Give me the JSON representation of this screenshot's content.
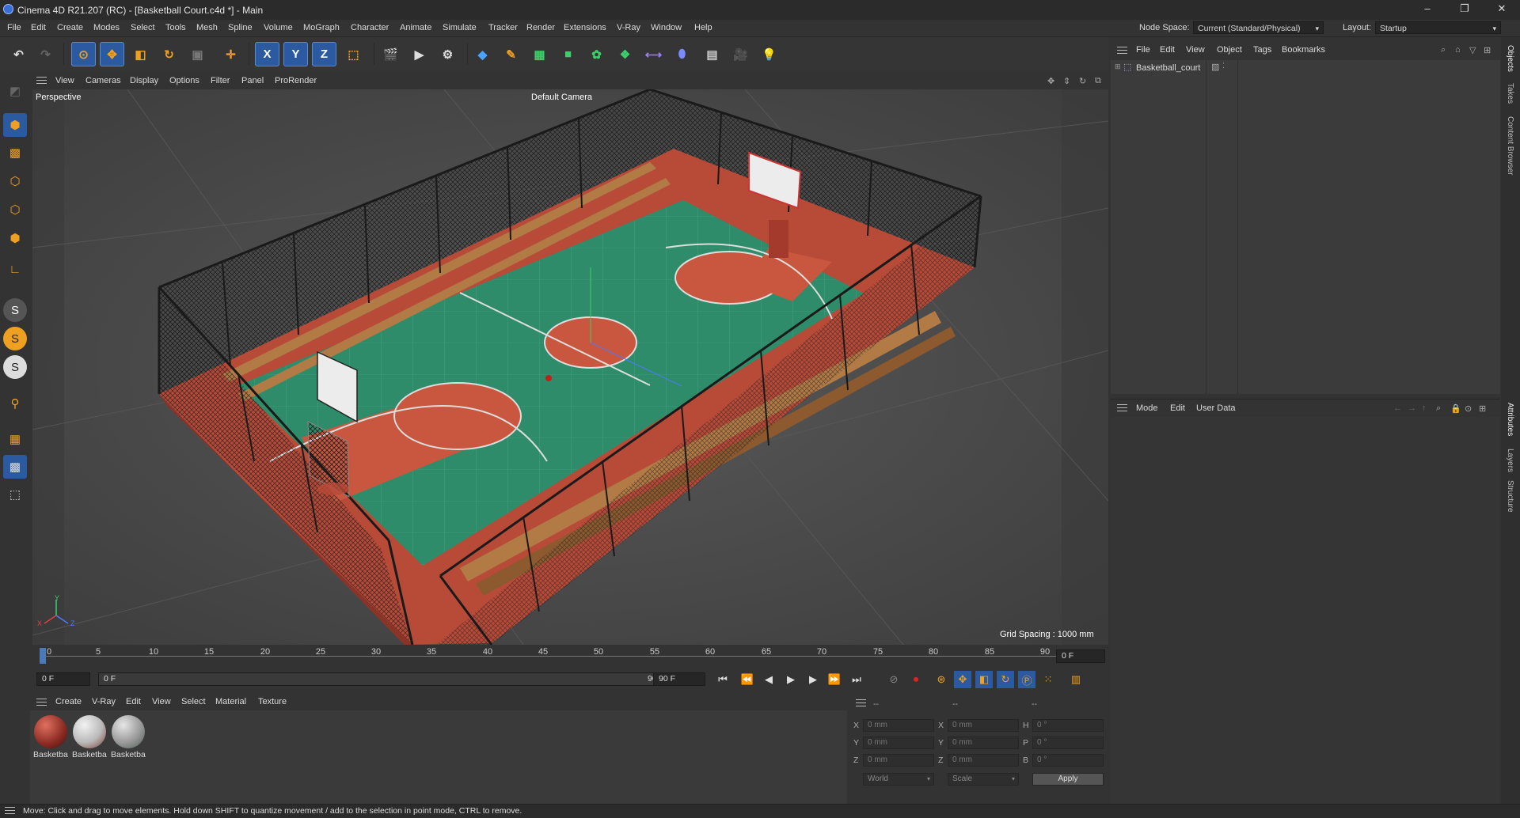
{
  "title_bar": {
    "title": "Cinema 4D R21.207 (RC) - [Basketball Court.c4d *] - Main"
  },
  "menu": {
    "items": [
      "File",
      "Edit",
      "Create",
      "Modes",
      "Select",
      "Tools",
      "Mesh",
      "Spline",
      "Volume",
      "MoGraph",
      "Character",
      "Animate",
      "Simulate",
      "Tracker",
      "Render",
      "Extensions",
      "V-Ray",
      "Window",
      "Help"
    ],
    "node_space_label": "Node Space:",
    "node_space_value": "Current (Standard/Physical)",
    "layout_label": "Layout:",
    "layout_value": "Startup"
  },
  "toolbar": {
    "axis_x": "X",
    "axis_y": "Y",
    "axis_z": "Z"
  },
  "left_tools": {
    "s1": "S",
    "s2": "S",
    "s3": "S"
  },
  "viewport": {
    "menu": [
      "View",
      "Cameras",
      "Display",
      "Options",
      "Filter",
      "Panel",
      "ProRender"
    ],
    "label": "Perspective",
    "camera": "Default Camera",
    "grid_spacing": "Grid Spacing : 1000 mm",
    "axis_y": "Y",
    "axis_x": "X",
    "axis_z": "Z"
  },
  "timeline": {
    "ticks": [
      "0",
      "5",
      "10",
      "15",
      "20",
      "25",
      "30",
      "35",
      "40",
      "45",
      "50",
      "55",
      "60",
      "65",
      "70",
      "75",
      "80",
      "85",
      "90"
    ],
    "current_frame": "0 F"
  },
  "transport": {
    "start_frame": "0 F",
    "range_start": "0 F",
    "range_end": "90 F",
    "end_frame": "90 F"
  },
  "material_manager": {
    "menu": [
      "Create",
      "V-Ray",
      "Edit",
      "View",
      "Select",
      "Material",
      "Texture"
    ],
    "materials": [
      {
        "name": "Basketba",
        "color": "#8a2a22"
      },
      {
        "name": "Basketba",
        "color": "#b9b9b9"
      },
      {
        "name": "Basketba",
        "color": "#9a9a9a"
      }
    ]
  },
  "coordinates": {
    "header_dashes": [
      "--",
      "--",
      "--"
    ],
    "pos_labels": [
      "X",
      "Y",
      "Z"
    ],
    "size_labels": [
      "X",
      "Y",
      "Z"
    ],
    "rot_labels": [
      "H",
      "P",
      "B"
    ],
    "pos_values": [
      "0 mm",
      "0 mm",
      "0 mm"
    ],
    "size_values": [
      "0 mm",
      "0 mm",
      "0 mm"
    ],
    "rot_values": [
      "0 °",
      "0 °",
      "0 °"
    ],
    "world_select": "World",
    "scale_select": "Scale",
    "apply_label": "Apply"
  },
  "object_manager": {
    "menu": [
      "File",
      "Edit",
      "View",
      "Object",
      "Tags",
      "Bookmarks"
    ],
    "objects": [
      {
        "name": "Basketball_court"
      }
    ]
  },
  "attribute_manager": {
    "menu": [
      "Mode",
      "Edit",
      "User Data"
    ]
  },
  "right_tabs": {
    "top": [
      "Objects",
      "Takes",
      "Content Browser"
    ],
    "bottom": [
      "Attributes",
      "Layers",
      "Structure"
    ]
  },
  "status_bar": {
    "text": "Move: Click and drag to move elements. Hold down SHIFT to quantize movement / add to the selection in point mode, CTRL to remove."
  },
  "colors": {
    "accent_blue": "#2b5aa0",
    "court_green": "#2f8c6a",
    "court_red": "#c9573f",
    "record_red": "#d62626"
  }
}
